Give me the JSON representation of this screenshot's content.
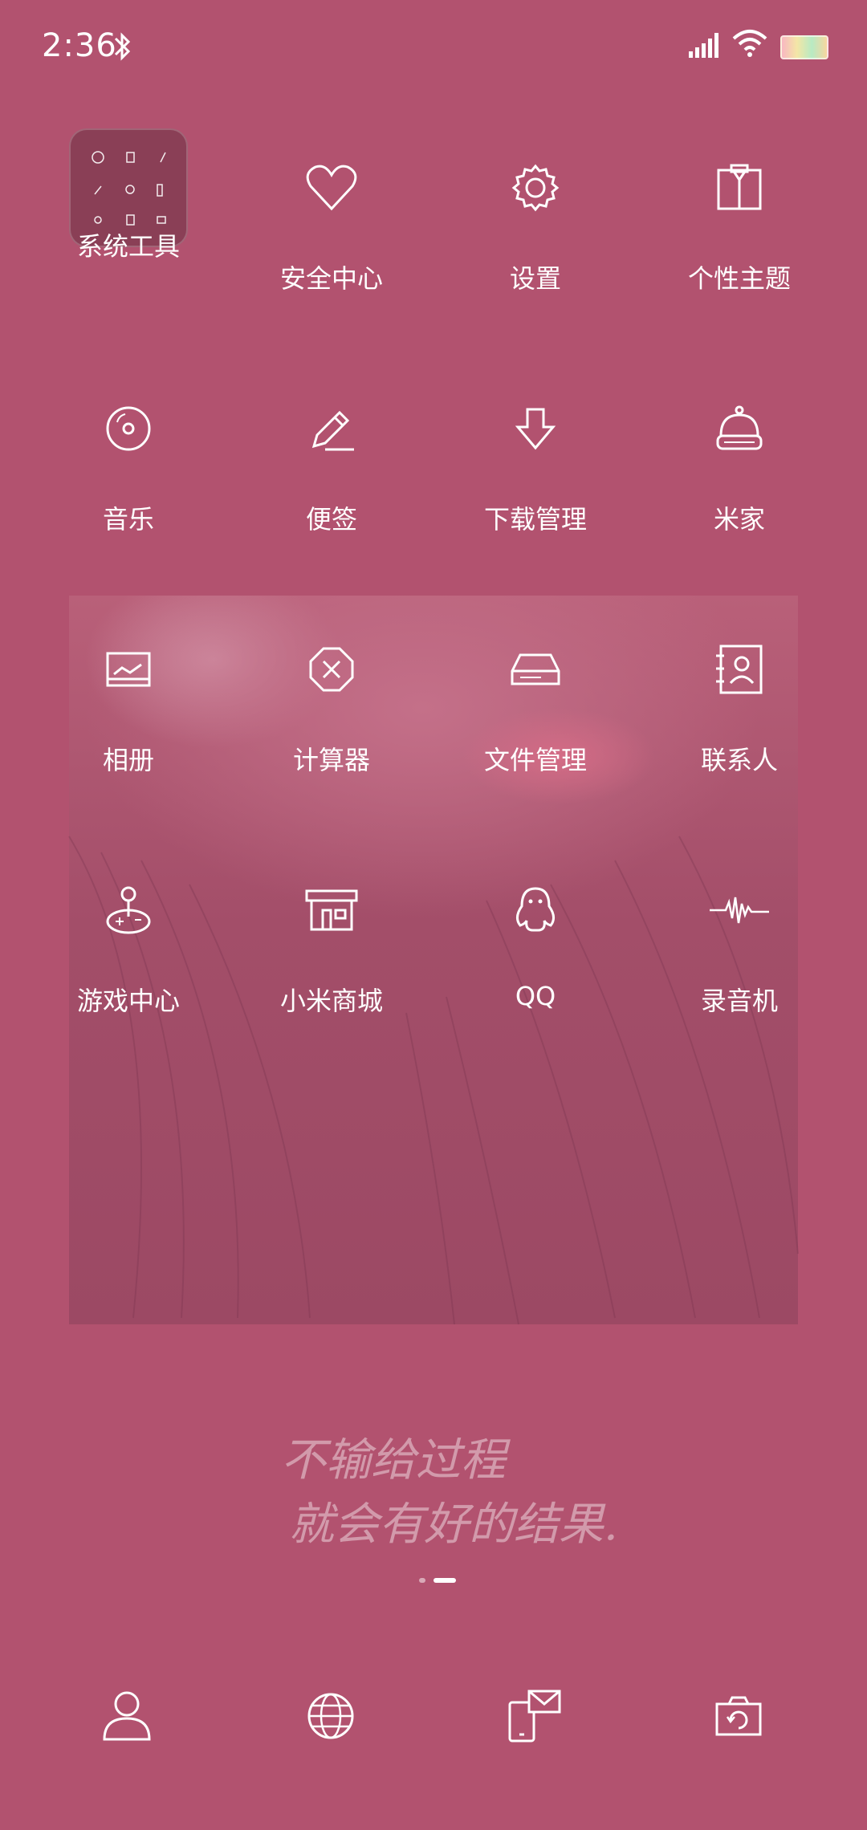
{
  "status_bar": {
    "time": "2:36",
    "icons": [
      "bluetooth-icon",
      "signal-icon",
      "wifi-icon",
      "battery-icon"
    ]
  },
  "apps": [
    {
      "label": "系统工具",
      "icon": "folder-icon"
    },
    {
      "label": "安全中心",
      "icon": "heart-icon"
    },
    {
      "label": "设置",
      "icon": "gear-icon"
    },
    {
      "label": "个性主题",
      "icon": "shirt-icon"
    },
    {
      "label": "音乐",
      "icon": "disc-icon"
    },
    {
      "label": "便签",
      "icon": "pencil-icon"
    },
    {
      "label": "下载管理",
      "icon": "download-arrow-icon"
    },
    {
      "label": "米家",
      "icon": "smart-home-icon"
    },
    {
      "label": "相册",
      "icon": "gallery-icon"
    },
    {
      "label": "计算器",
      "icon": "calculator-icon"
    },
    {
      "label": "文件管理",
      "icon": "file-drive-icon"
    },
    {
      "label": "联系人",
      "icon": "contacts-icon"
    },
    {
      "label": "游戏中心",
      "icon": "joystick-icon"
    },
    {
      "label": "小米商城",
      "icon": "store-icon"
    },
    {
      "label": "QQ",
      "icon": "penguin-icon"
    },
    {
      "label": "录音机",
      "icon": "soundwave-icon"
    }
  ],
  "quote": {
    "line1": "不输给过程",
    "line2": "就会有好的结果."
  },
  "page_indicator": {
    "pages": 2,
    "current": 2
  },
  "dock": [
    {
      "icon": "person-icon"
    },
    {
      "icon": "globe-icon"
    },
    {
      "icon": "message-phone-icon"
    },
    {
      "icon": "camera-icon"
    }
  ],
  "colors": {
    "background": "#b2526f",
    "photo_tint": "#a34e69"
  }
}
